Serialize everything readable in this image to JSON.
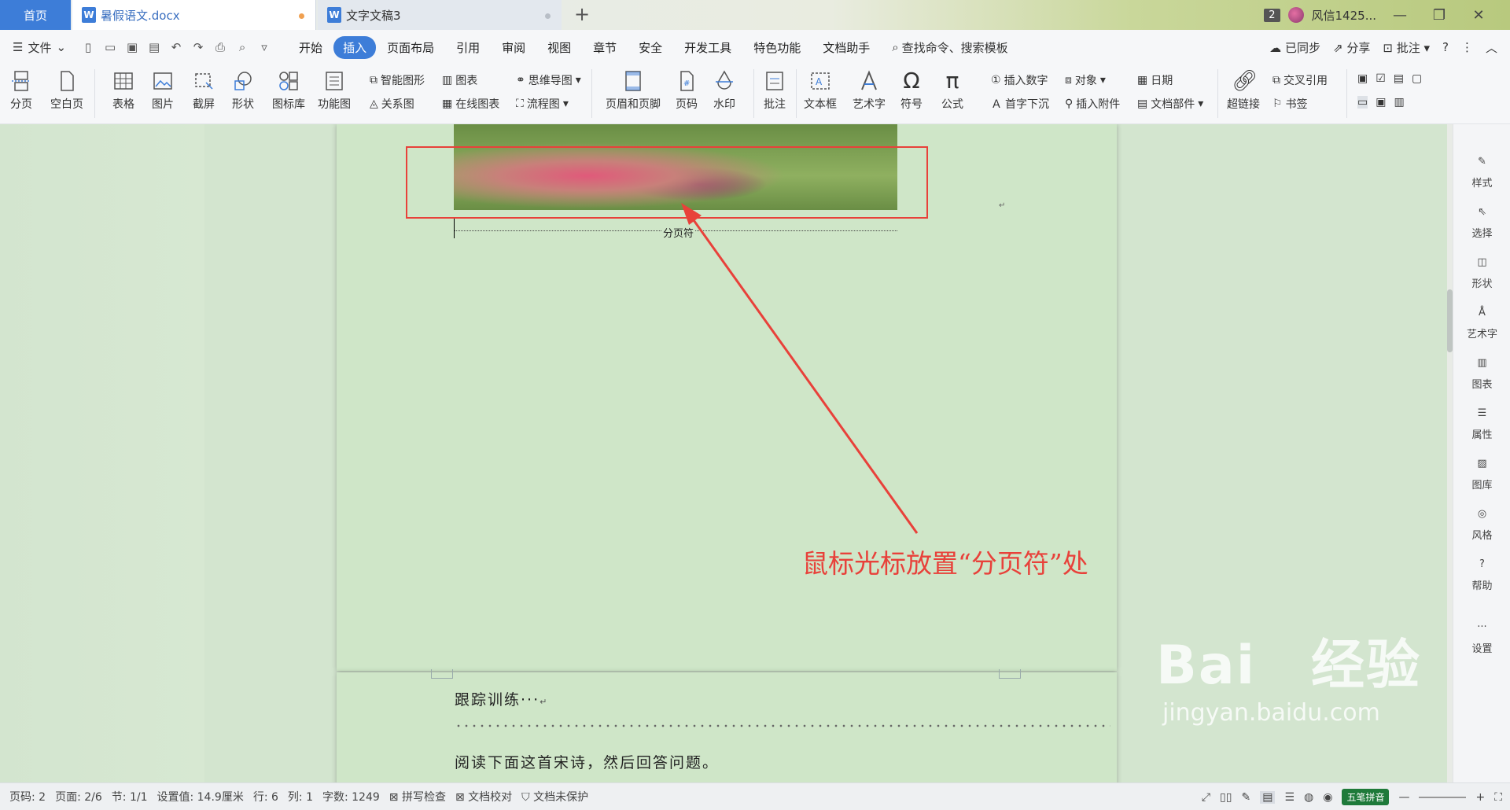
{
  "tabs": {
    "home": "首页",
    "doc1": "暑假语文.docx",
    "doc2": "文字文稿3",
    "doc_icon": "W"
  },
  "titlebar": {
    "count_badge": "2",
    "user_name": "风信1425..."
  },
  "menubar": {
    "file": "文件",
    "tabs": [
      "开始",
      "插入",
      "页面布局",
      "引用",
      "审阅",
      "视图",
      "章节",
      "安全",
      "开发工具",
      "特色功能",
      "文档助手"
    ],
    "active_tab": "插入",
    "search": "查找命令、搜索模板",
    "synced": "已同步",
    "share": "分享",
    "comment": "批注"
  },
  "ribbon": {
    "page_break": "分页",
    "blank_page": "空白页",
    "table": "表格",
    "picture": "图片",
    "screenshot": "截屏",
    "shape": "形状",
    "icon_lib": "图标库",
    "func_chart": "功能图",
    "smart_graphic": "智能图形",
    "relation_chart": "关系图",
    "chart": "图表",
    "online_chart": "在线图表",
    "mind_map": "思维导图",
    "flow_chart": "流程图",
    "header_footer": "页眉和页脚",
    "page_number": "页码",
    "watermark": "水印",
    "comment": "批注",
    "textbox": "文本框",
    "wordart": "艺术字",
    "symbol": "符号",
    "formula": "公式",
    "insert_number": "插入数字",
    "drop_cap": "首字下沉",
    "object": "对象",
    "attachment": "插入附件",
    "date": "日期",
    "doc_parts": "文档部件",
    "hyperlink": "超链接",
    "cross_ref": "交叉引用",
    "bookmark": "书签"
  },
  "document": {
    "page_break_label": "分页符",
    "return_mark": "↵",
    "annotation": "鼠标光标放置“分页符”处",
    "page2_line1": "跟踪训练···",
    "page2_line2": "阅读下面这首宋诗，然后回答问题。"
  },
  "right_panel": {
    "items": [
      "样式",
      "选择",
      "形状",
      "艺术字",
      "图表",
      "属性",
      "图库",
      "风格",
      "帮助",
      "设置"
    ]
  },
  "statusbar": {
    "page_code": "页码: 2",
    "page": "页面: 2/6",
    "section": "节: 1/1",
    "setting": "设置值: 14.9厘米",
    "row": "行: 6",
    "col": "列: 1",
    "word_count": "字数: 1249",
    "spell_check": "拼写检查",
    "doc_proof": "文档校对",
    "doc_protect": "文档未保护",
    "ime": "五笔拼音"
  },
  "watermark": {
    "brand": "Bai du 经验",
    "url": "jingyan.baidu.com"
  },
  "colors": {
    "accent": "#3d7dd8",
    "annotation_red": "#e8413a",
    "page_bg": "#cfe6c8"
  }
}
